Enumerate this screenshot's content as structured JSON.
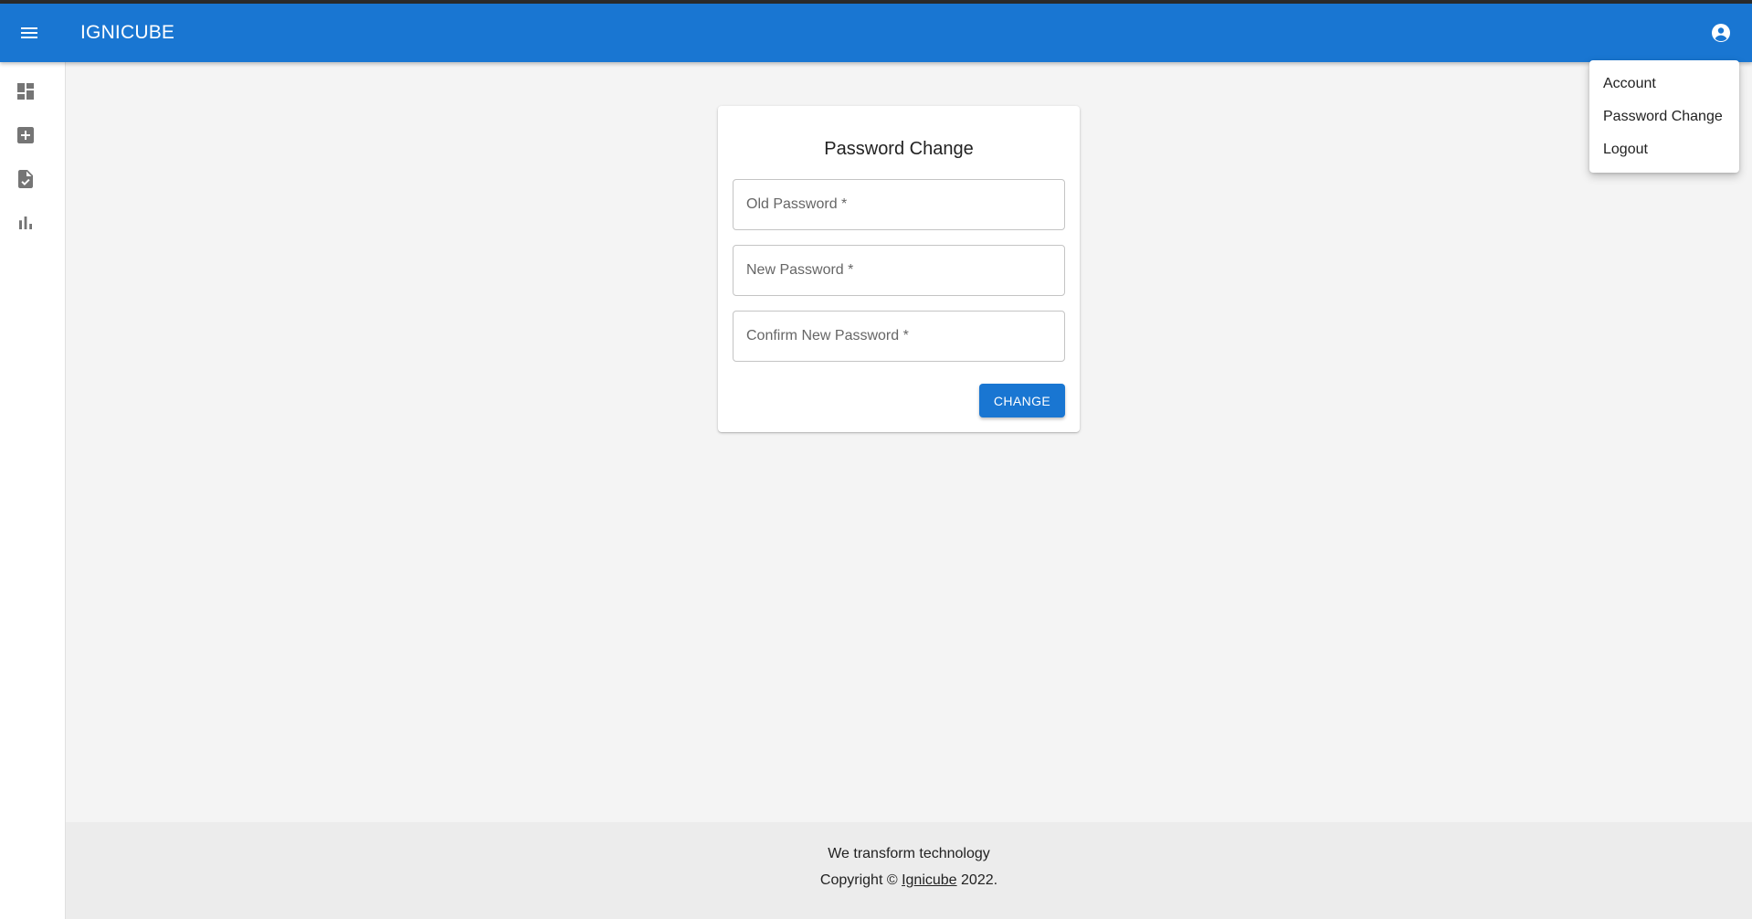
{
  "app": {
    "title": "IGNICUBE",
    "brand_color": "#1976d2"
  },
  "header": {
    "menu_icon": "menu-icon",
    "account_icon": "account-circle-icon"
  },
  "sidebar": {
    "items": [
      {
        "name": "dashboard",
        "icon": "dashboard-icon"
      },
      {
        "name": "add",
        "icon": "add-box-icon"
      },
      {
        "name": "document-check",
        "icon": "document-check-icon"
      },
      {
        "name": "bar-chart",
        "icon": "bar-chart-icon"
      }
    ]
  },
  "form": {
    "title": "Password Change",
    "old_password_placeholder": "Old Password *",
    "new_password_placeholder": "New Password *",
    "confirm_password_placeholder": "Confirm New Password *",
    "submit_label": "CHANGE"
  },
  "account_menu": {
    "items": [
      "Account",
      "Password Change",
      "Logout"
    ]
  },
  "footer": {
    "tagline": "We transform technology",
    "copyright_prefix": "Copyright © ",
    "company_link": "Ignicube",
    "copyright_suffix": " 2022."
  }
}
